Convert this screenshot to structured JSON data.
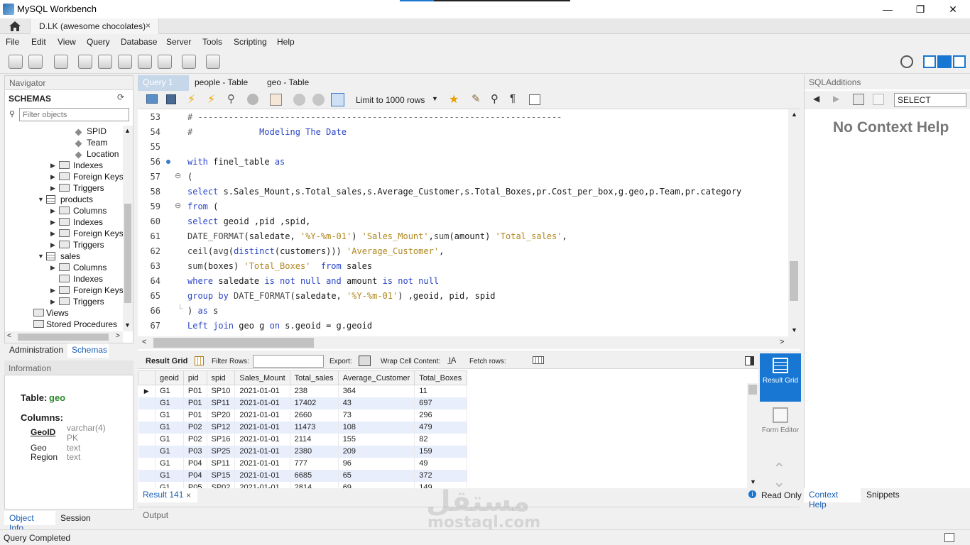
{
  "window": {
    "title": "MySQL Workbench",
    "minimize": "—",
    "maximize": "❐",
    "close": "✕"
  },
  "connection_tab": {
    "label": "D.LK (awesome chocolates)",
    "close": "×"
  },
  "menu": [
    "File",
    "Edit",
    "View",
    "Query",
    "Database",
    "Server",
    "Tools",
    "Scripting",
    "Help"
  ],
  "navigator": {
    "header": "Navigator",
    "schemas_label": "SCHEMAS",
    "filter_placeholder": "Filter objects",
    "tree": [
      {
        "label": "SPID",
        "type": "column"
      },
      {
        "label": "Team",
        "type": "column"
      },
      {
        "label": "Location",
        "type": "column"
      },
      {
        "label": "Indexes",
        "type": "folder"
      },
      {
        "label": "Foreign Keys",
        "type": "folder"
      },
      {
        "label": "Triggers",
        "type": "folder"
      },
      {
        "label": "products",
        "type": "table"
      },
      {
        "label": "Columns",
        "type": "folder"
      },
      {
        "label": "Indexes",
        "type": "folder"
      },
      {
        "label": "Foreign Keys",
        "type": "folder"
      },
      {
        "label": "Triggers",
        "type": "folder"
      },
      {
        "label": "sales",
        "type": "table"
      },
      {
        "label": "Columns",
        "type": "folder"
      },
      {
        "label": "Indexes",
        "type": "folder"
      },
      {
        "label": "Foreign Keys",
        "type": "folder"
      },
      {
        "label": "Triggers",
        "type": "folder"
      },
      {
        "label": "Views",
        "type": "folder"
      },
      {
        "label": "Stored Procedures",
        "type": "folder"
      }
    ]
  },
  "admin_tabs": {
    "administration": "Administration",
    "schemas": "Schemas"
  },
  "information": {
    "header": "Information",
    "table_label": "Table:",
    "table_name": "geo",
    "columns_label": "Columns:",
    "columns": [
      {
        "name": "GeoID",
        "type": "varchar(4)",
        "extra": "PK"
      },
      {
        "name": "Geo",
        "type": "text"
      },
      {
        "name": "Region",
        "type": "text"
      }
    ]
  },
  "object_tabs": {
    "object_info": "Object Info",
    "session": "Session"
  },
  "query_tabs": [
    "Query 1",
    "people - Table",
    "geo - Table"
  ],
  "query_toolbar": {
    "limit": "Limit to 1000 rows"
  },
  "editor": {
    "line_numbers": [
      "53",
      "54",
      "55",
      "56",
      "57",
      "58",
      "59",
      "60",
      "61",
      "62",
      "63",
      "64",
      "65",
      "66",
      "67"
    ]
  },
  "result": {
    "grid_label": "Result Grid",
    "filter_label": "Filter Rows:",
    "export_label": "Export:",
    "wrap_label": "Wrap Cell Content:",
    "fetch_label": "Fetch rows:",
    "columns": [
      "geoid",
      "pid",
      "spid",
      "Sales_Mount",
      "Total_sales",
      "Average_Customer",
      "Total_Boxes"
    ],
    "rows": [
      [
        "G1",
        "P01",
        "SP10",
        "2021-01-01",
        "238",
        "364",
        "11"
      ],
      [
        "G1",
        "P01",
        "SP11",
        "2021-01-01",
        "17402",
        "43",
        "697"
      ],
      [
        "G1",
        "P01",
        "SP20",
        "2021-01-01",
        "2660",
        "73",
        "296"
      ],
      [
        "G1",
        "P02",
        "SP12",
        "2021-01-01",
        "11473",
        "108",
        "479"
      ],
      [
        "G1",
        "P02",
        "SP16",
        "2021-01-01",
        "2114",
        "155",
        "82"
      ],
      [
        "G1",
        "P03",
        "SP25",
        "2021-01-01",
        "2380",
        "209",
        "159"
      ],
      [
        "G1",
        "P04",
        "SP11",
        "2021-01-01",
        "777",
        "96",
        "49"
      ],
      [
        "G1",
        "P04",
        "SP15",
        "2021-01-01",
        "6685",
        "65",
        "372"
      ],
      [
        "G1",
        "P05",
        "SP02",
        "2021-01-01",
        "2814",
        "69",
        "149"
      ]
    ],
    "tab_label": "Result 141",
    "tab_close": "×",
    "read_only": "Read Only",
    "side_grid": "Result Grid",
    "side_form": "Form Editor"
  },
  "output_label": "Output",
  "sql_additions": {
    "header": "SQLAdditions",
    "select_value": "SELECT",
    "no_help": "No Context Help",
    "tab_context": "Context Help",
    "tab_snippets": "Snippets"
  },
  "status": "Query Completed",
  "watermark": {
    "arabic": "مستقل",
    "latin": "mostaql.com"
  }
}
